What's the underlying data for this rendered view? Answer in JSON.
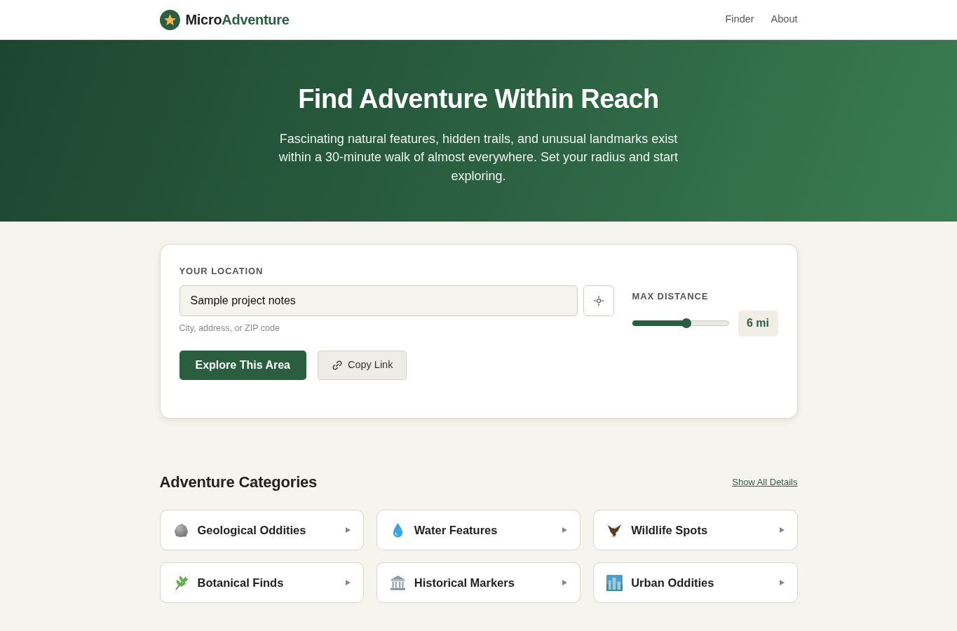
{
  "brand": {
    "name": "Micro",
    "accent": "Adventure"
  },
  "nav": [
    {
      "label": "Finder"
    },
    {
      "label": "About"
    }
  ],
  "hero": {
    "title": "Find Adventure Within Reach",
    "text": "Fascinating natural features, hidden trails, and unusual landmarks exist within a 30-minute walk of almost everywhere. Set your radius and start exploring."
  },
  "search": {
    "label": "YOUR LOCATION",
    "value": "Sample project notes",
    "hint": "City, address, or ZIP code",
    "buttons": [
      {
        "label": "Explore This Area",
        "kind": "primary"
      },
      {
        "label": "Copy Link",
        "kind": "link"
      }
    ]
  },
  "distance": {
    "label": "MAX DISTANCE",
    "level": 0.56,
    "reading": "6 mi"
  },
  "categories": {
    "title": "Adventure Categories",
    "link": "Show All Details",
    "items": [
      {
        "label": "Geological Oddities"
      },
      {
        "label": "Water Features"
      },
      {
        "label": "Wildlife Spots"
      },
      {
        "label": "Botanical Finds"
      },
      {
        "label": "Historical Markers"
      },
      {
        "label": "Urban Oddities"
      }
    ]
  }
}
